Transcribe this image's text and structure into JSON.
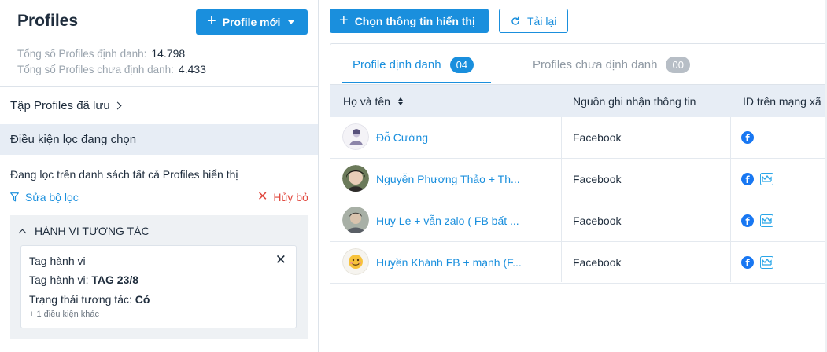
{
  "left": {
    "title": "Profiles",
    "new_profile_button": "Profile mới",
    "stats": [
      {
        "label": "Tổng số Profiles định danh:",
        "value": "14.798"
      },
      {
        "label": "Tổng số Profiles chưa định danh:",
        "value": "4.433"
      }
    ],
    "saved_sets": "Tập Profiles đã lưu",
    "current_conditions": "Điều kiện lọc đang chọn",
    "filter_description": "Đang lọc trên danh sách tất cả Profiles hiển thị",
    "edit_filter": "Sửa bộ lọc",
    "cancel": "Hủy bỏ",
    "group": {
      "title": "HÀNH VI TƯƠNG TÁC",
      "card": {
        "line1": "Tag hành vi",
        "line2_label": "Tag hành vi:",
        "line2_value": "TAG 23/8",
        "line3_label": "Trạng thái tương tác:",
        "line3_value": "Có",
        "more": "+ 1 điều kiện khác"
      }
    }
  },
  "right": {
    "choose_fields_button": "Chọn thông tin hiển thị",
    "reload_button": "Tải lại",
    "tabs": [
      {
        "label": "Profile định danh",
        "count": "04",
        "active": true
      },
      {
        "label": "Profiles chưa định danh",
        "count": "00",
        "active": false
      }
    ],
    "columns": [
      "Họ và tên",
      "Nguồn ghi nhận thông tin",
      "ID trên mạng xã"
    ],
    "rows": [
      {
        "name": "Đỗ Cường",
        "source": "Facebook",
        "ids": [
          "facebook"
        ]
      },
      {
        "name": "Nguyễn Phương Thảo + Th...",
        "source": "Facebook",
        "ids": [
          "facebook",
          "zalo"
        ]
      },
      {
        "name": "Huy Le + vẫn zalo ( FB bất ...",
        "source": "Facebook",
        "ids": [
          "facebook",
          "zalo"
        ]
      },
      {
        "name": "Huyền Khánh FB + mạnh (F...",
        "source": "Facebook",
        "ids": [
          "facebook",
          "zalo"
        ]
      }
    ]
  },
  "colors": {
    "primary": "#1a8fdd",
    "danger": "#e0483e",
    "header_bg": "#e7edf5",
    "facebook": "#1877f2"
  },
  "icons": [
    "plus-icon",
    "caret-down-icon",
    "chevron-right-icon",
    "filter-icon",
    "close-icon",
    "chevron-up-icon",
    "reload-icon",
    "sort-icon",
    "facebook-icon",
    "zalo-icon"
  ]
}
